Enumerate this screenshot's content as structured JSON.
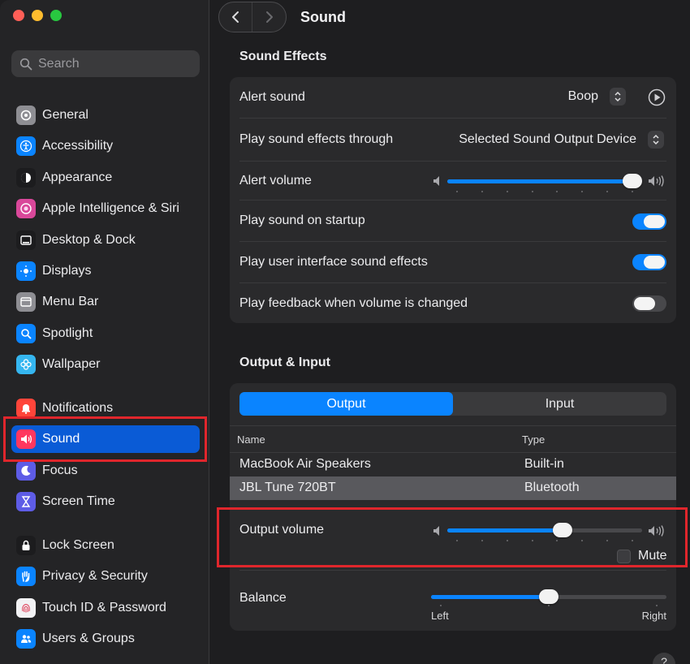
{
  "window": {
    "title": "Sound"
  },
  "search": {
    "placeholder": "Search"
  },
  "sidebar": {
    "items": [
      {
        "label": "General",
        "icon": "gear-icon",
        "color": "#8e8e93"
      },
      {
        "label": "Accessibility",
        "icon": "accessibility-icon",
        "color": "#0a84ff"
      },
      {
        "label": "Appearance",
        "icon": "appearance-icon",
        "color": "#1c1c1e"
      },
      {
        "label": "Apple Intelligence & Siri",
        "icon": "siri-icon",
        "color": "#d9489a"
      },
      {
        "label": "Desktop & Dock",
        "icon": "dock-icon",
        "color": "#1c1c1e"
      },
      {
        "label": "Displays",
        "icon": "sun-icon",
        "color": "#0a84ff"
      },
      {
        "label": "Menu Bar",
        "icon": "menubar-icon",
        "color": "#8e8e93"
      },
      {
        "label": "Spotlight",
        "icon": "magnifier-icon",
        "color": "#0a84ff"
      },
      {
        "label": "Wallpaper",
        "icon": "flower-icon",
        "color": "#35b6f0"
      },
      {
        "label": "Notifications",
        "icon": "bell-icon",
        "color": "#ff453a"
      },
      {
        "label": "Sound",
        "icon": "speaker-icon",
        "color": "#ff375f"
      },
      {
        "label": "Focus",
        "icon": "moon-icon",
        "color": "#5e5ce6"
      },
      {
        "label": "Screen Time",
        "icon": "hourglass-icon",
        "color": "#5e5ce6"
      },
      {
        "label": "Lock Screen",
        "icon": "lock-icon",
        "color": "#1c1c1e"
      },
      {
        "label": "Privacy & Security",
        "icon": "hand-icon",
        "color": "#0a84ff"
      },
      {
        "label": "Touch ID & Password",
        "icon": "fingerprint-icon",
        "color": "#f2f2f4"
      },
      {
        "label": "Users & Groups",
        "icon": "users-icon",
        "color": "#0a84ff"
      }
    ],
    "selected": "Sound"
  },
  "sound_effects": {
    "title": "Sound Effects",
    "alert_sound": {
      "label": "Alert sound",
      "value": "Boop"
    },
    "play_through": {
      "label": "Play sound effects through",
      "value": "Selected Sound Output Device"
    },
    "alert_volume": {
      "label": "Alert volume",
      "level": 1.0
    },
    "startup": {
      "label": "Play sound on startup",
      "on": true
    },
    "ui_effects": {
      "label": "Play user interface sound effects",
      "on": true
    },
    "feedback": {
      "label": "Play feedback when volume is changed",
      "on": false
    }
  },
  "output_input": {
    "title": "Output & Input",
    "tabs": [
      "Output",
      "Input"
    ],
    "active_tab": "Output",
    "columns": [
      "Name",
      "Type"
    ],
    "devices": [
      {
        "name": "MacBook Air Speakers",
        "type": "Built-in",
        "selected": false
      },
      {
        "name": "JBL Tune 720BT",
        "type": "Bluetooth",
        "selected": true
      }
    ],
    "output_volume": {
      "label": "Output volume",
      "level": 0.6
    },
    "mute": {
      "label": "Mute",
      "checked": false
    },
    "balance": {
      "label": "Balance",
      "level": 0.5,
      "left": "Left",
      "right": "Right"
    }
  },
  "help": {
    "label": "?"
  },
  "colors": {
    "accent": "#0a84ff",
    "highlight": "#e0262c",
    "selected_sidebar": "#0a5bd6"
  }
}
